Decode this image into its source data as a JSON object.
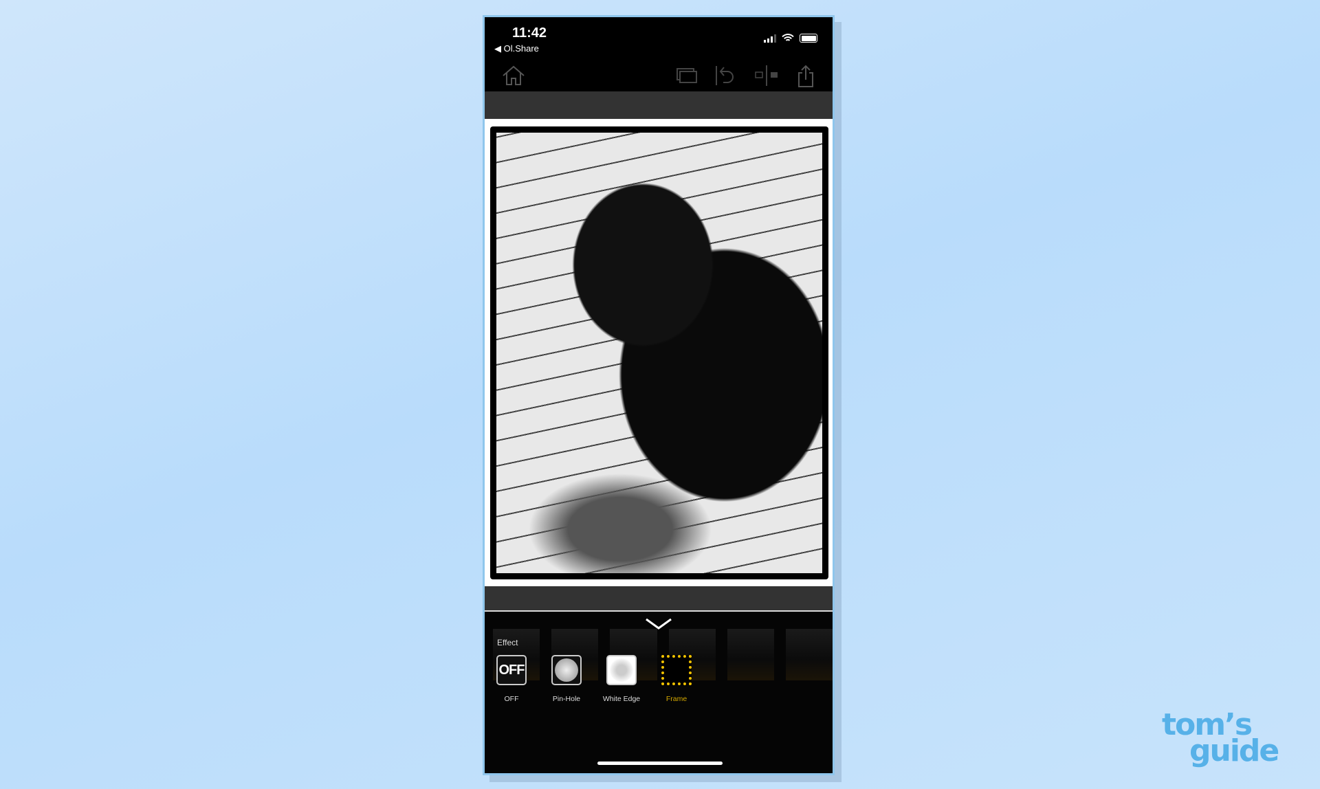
{
  "status": {
    "time": "11:42",
    "back_app": "Ol.Share"
  },
  "toolbar": {
    "icons": [
      "home-icon",
      "layers-icon",
      "undo-icon",
      "compare-icon",
      "share-icon"
    ]
  },
  "panel": {
    "section_label": "Effect",
    "effects": [
      {
        "label": "OFF",
        "icon_text": "OFF",
        "selected": false
      },
      {
        "label": "Pin-Hole",
        "selected": false
      },
      {
        "label": "White Edge",
        "selected": false
      },
      {
        "label": "Frame",
        "selected": true
      }
    ],
    "accent_color": "#f2c200"
  },
  "watermark": {
    "line1": "tom's",
    "line2": "guide"
  }
}
